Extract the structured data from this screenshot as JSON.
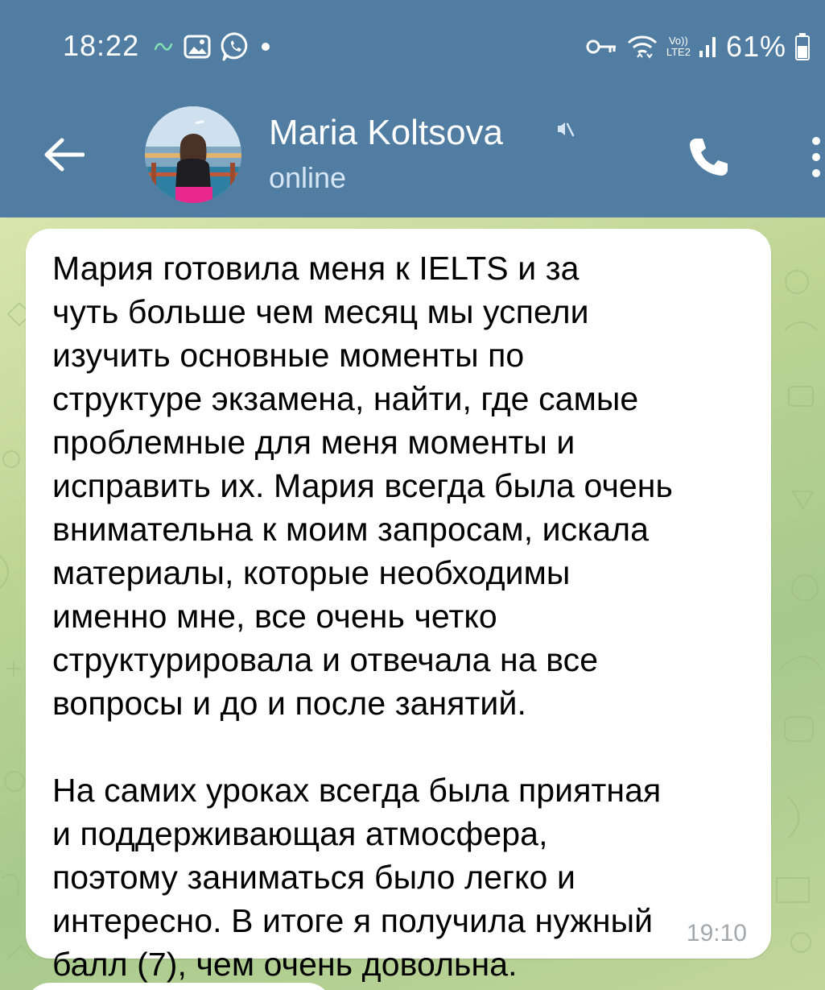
{
  "status_bar": {
    "time": "18:22",
    "battery": "61%",
    "network_label_top": "Vo))",
    "network_label_bottom": "LTE2"
  },
  "header": {
    "contact_name": "Maria Koltsova",
    "contact_status": "online"
  },
  "message": {
    "text": "Мария готовила меня к IELTS и за\nчуть больше чем месяц мы успели\nизучить основные моменты по\nструктуре экзамена, найти, где самые\nпроблемные для меня моменты и\nисправить их. Мария всегда была очень\nвнимательна к моим запросам, искала\nматериалы, которые необходимы\nименно мне, все очень четко\nструктурировала и отвечала на все\nвопросы и до и после занятий.\n\nНа самих уроках всегда была приятная\nи поддерживающая атмосфера,\nпоэтому заниматься было легко и\nинтересно. В итоге я получила нужный\nбалл (7), чем очень довольна.",
    "time": "19:10"
  },
  "icons": {
    "status_left": [
      "link-icon",
      "gallery-icon",
      "whatsapp-icon",
      "dot-icon"
    ],
    "status_right": [
      "vpn-key-icon",
      "wifi-icon",
      "volte-icon",
      "signal-icon",
      "battery-icon"
    ],
    "header": [
      "back-arrow-icon",
      "mute-icon",
      "phone-icon",
      "more-vertical-icon"
    ]
  },
  "colors": {
    "header_bg": "#517da2",
    "bubble_bg": "#ffffff",
    "time_text": "#a3a8ad"
  }
}
